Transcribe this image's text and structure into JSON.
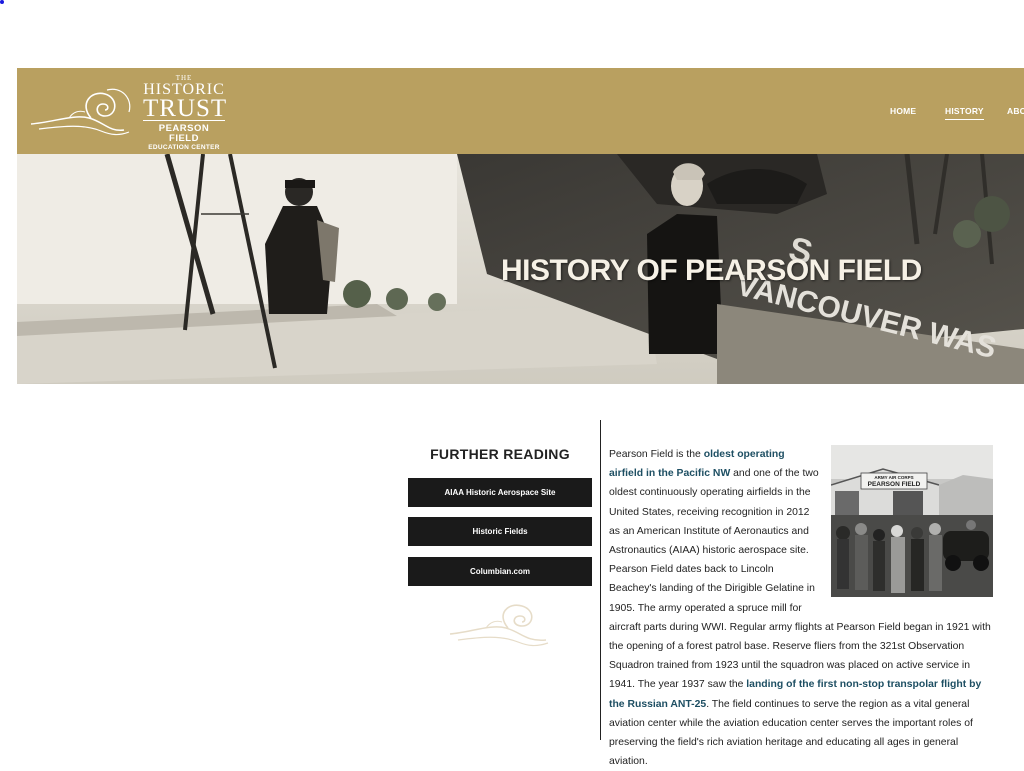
{
  "logo": {
    "the": "THE",
    "historic": "HISTORIC",
    "trust": "TRUST",
    "pearson_field": "PEARSON FIELD",
    "education_center": "EDUCATION CENTER"
  },
  "nav": {
    "home": "HOME",
    "history": "HISTORY",
    "about": "ABO"
  },
  "hero": {
    "title": "HISTORY OF PEARSON FIELD",
    "plane_text_1": "S",
    "plane_text_2": "VANCOUVER WAS"
  },
  "further_reading": {
    "title": "FURTHER READING",
    "links": [
      {
        "label": "AIAA Historic Aerospace Site"
      },
      {
        "label": "Historic Fields"
      },
      {
        "label": "Columbian.com"
      }
    ]
  },
  "photo": {
    "sign_top": "ARMY AIR CORPS",
    "sign_main": "PEARSON FIELD"
  },
  "article": {
    "p1": "Pearson Field is the ",
    "link1": "oldest operating airfield in the Pacific NW",
    "p2": " and one of the two oldest continuously operating airfields in the United States, receiving recognition in 2012 as an American Institute of Aeronautics and Astronautics (AIAA) historic aerospace site. Pearson Field dates back to Lincoln Beachey's landing of the Dirigible Gelatine in 1905. The army operated a spruce mill for aircraft parts during WWI. Regular army flights at Pearson Field began in 1921 with the opening of a forest patrol base. Reserve fliers from the 321st Observation Squadron trained from 1923 until the squadron was placed on active service in 1941. The year 1937 saw the ",
    "link2": "landing of the first non-stop transpolar flight by the Russian ANT-25",
    "p3": ". The field continues to serve the region as a vital general aviation center while the aviation education center serves the important roles of preserving the field's rich aviation heritage and educating all ages in general aviation."
  },
  "colors": {
    "header_gold": "#b9a060",
    "button_dark": "#1a1a1a",
    "link_teal": "#1e4f63"
  }
}
